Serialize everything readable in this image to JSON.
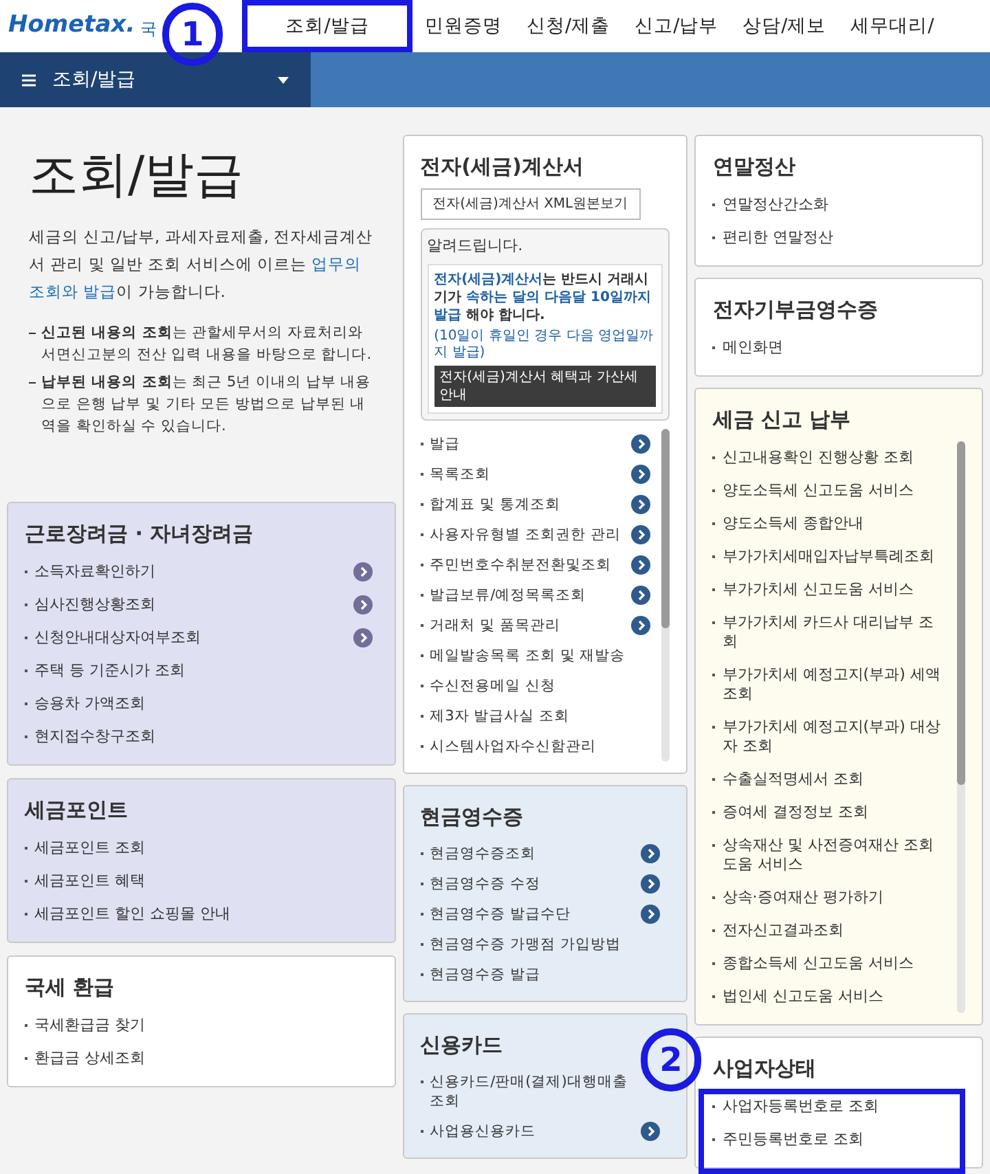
{
  "header": {
    "brand": "Hometax.",
    "subtitle": "국",
    "nav": [
      "조회/발급",
      "민원증명",
      "신청/제출",
      "신고/납부",
      "상담/제보",
      "세무대리/"
    ]
  },
  "menu_bar": {
    "title": "조회/발급"
  },
  "intro": {
    "title": "조회/발급",
    "paragraph": [
      {
        "text": "세금의 신고/납부, 과세자료제출, 전자세금계산서 관리 및 일반 조회 서비스에 이르는 ",
        "highlight": false
      },
      {
        "text": "업무의 조회와 발급",
        "highlight": true
      },
      {
        "text": "이 가능합니다.",
        "highlight": false
      }
    ],
    "notes": [
      "**신고된 내용의 조회**는 관할세무서의 자료처리와 서면신고분의 전산 입력 내용을 바탕으로 합니다.",
      "**납부된 내용의 조회**는 최근 5년 이내의 납부 내용으로 은행 납부 및 기타 모든 방법으로 납부된 내역을 확인하실 수 있습니다."
    ]
  },
  "columns": [
    [
      {
        "title": "근로장려금 · 자녀장려금",
        "color": "#dfe0f2",
        "kind": "plain",
        "items": [
          {
            "label": "소득자료확인하기",
            "arrow": true
          },
          {
            "label": "심사진행상황조회",
            "arrow": true
          },
          {
            "label": "신청안내대상자여부조회",
            "arrow": true
          },
          {
            "label": "주택 등 기준시가 조회",
            "arrow": false
          },
          {
            "label": "승용차 가액조회",
            "arrow": false
          },
          {
            "label": "현지접수창구조회",
            "arrow": false
          }
        ]
      },
      {
        "title": "세금포인트",
        "color": "#dfe0f2",
        "kind": "plain",
        "items": [
          {
            "label": "세금포인트 조회",
            "arrow": false
          },
          {
            "label": "세금포인트 혜택",
            "arrow": false
          },
          {
            "label": "세금포인트 할인 쇼핑몰 안내",
            "arrow": false
          }
        ]
      },
      {
        "title": "국세 환급",
        "color": "#ffffff",
        "kind": "plain",
        "items": [
          {
            "label": "국세환급금 찾기",
            "arrow": false
          },
          {
            "label": "환급금 상세조회",
            "arrow": false
          }
        ]
      }
    ],
    [
      {
        "title": "전자(세금)계산서",
        "color": "#ffffff",
        "kind": "scroll",
        "button": "전자(세금)계산서 XML원본보기",
        "notice": {
          "title": "알려드립니다.",
          "body": [
            {
              "text": "전자(세금)계산서",
              "highlight": true
            },
            {
              "text": "는 반드시 거래시기가 ",
              "highlight": false
            },
            {
              "text": "속하는 달의 다음달 10일까지 발급",
              "highlight": true
            },
            {
              "text": " 해야 합니다.",
              "highlight": false
            }
          ],
          "note": "(10일이 휴일인 경우 다음 영업일까지 발급)",
          "link": "전자(세금)계산서 혜택과 가산세 안내"
        },
        "items": [
          {
            "label": "발급",
            "arrow": true
          },
          {
            "label": "목록조회",
            "arrow": true
          },
          {
            "label": "합계표 및 통계조회",
            "arrow": true
          },
          {
            "label": "사용자유형별 조회권한 관리",
            "arrow": true
          },
          {
            "label": "주민번호수취분전환및조회",
            "arrow": true
          },
          {
            "label": "발급보류/예정목록조회",
            "arrow": true
          },
          {
            "label": "거래처 및 품목관리",
            "arrow": true
          },
          {
            "label": "메일발송목록 조회 및 재발송",
            "arrow": false
          },
          {
            "label": "수신전용메일 신청",
            "arrow": false
          },
          {
            "label": "제3자 발급사실 조회",
            "arrow": false
          },
          {
            "label": "시스템사업자수신함관리",
            "arrow": false
          }
        ]
      },
      {
        "title": "현금영수증",
        "color": "#e4ecf5",
        "kind": "plain",
        "items": [
          {
            "label": "현금영수증조회",
            "arrow": true
          },
          {
            "label": "현금영수증 수정",
            "arrow": true
          },
          {
            "label": "현금영수증 발급수단",
            "arrow": true
          },
          {
            "label": "현금영수증 가맹점 가입방법",
            "arrow": false
          },
          {
            "label": "현금영수증 발급",
            "arrow": false
          }
        ]
      },
      {
        "title": "신용카드",
        "color": "#e4ecf5",
        "kind": "plain",
        "items": [
          {
            "label": "신용카드/판매(결제)대행매출 조회",
            "arrow": false
          },
          {
            "label": "사업용신용카드",
            "arrow": true
          }
        ]
      }
    ],
    [
      {
        "title": "연말정산",
        "color": "#ffffff",
        "kind": "plain",
        "items": [
          {
            "label": "연말정산간소화",
            "arrow": false
          },
          {
            "label": "편리한 연말정산",
            "arrow": false
          }
        ]
      },
      {
        "title": "전자기부금영수증",
        "color": "#ffffff",
        "kind": "plain",
        "items": [
          {
            "label": "메인화면",
            "arrow": false
          }
        ]
      },
      {
        "title": "세금 신고 납부",
        "color": "#fdfcee",
        "kind": "scroll",
        "items": [
          {
            "label": "신고내용확인 진행상황 조회",
            "arrow": false
          },
          {
            "label": "양도소득세 신고도움 서비스",
            "arrow": false
          },
          {
            "label": "양도소득세 종합안내",
            "arrow": false
          },
          {
            "label": "부가가치세매입자납부특례조회",
            "arrow": false
          },
          {
            "label": "부가가치세 신고도움 서비스",
            "arrow": false
          },
          {
            "label": "부가가치세 카드사 대리납부 조회",
            "arrow": false
          },
          {
            "label": "부가가치세 예정고지(부과) 세액조회",
            "arrow": false
          },
          {
            "label": "부가가치세 예정고지(부과) 대상자 조회",
            "arrow": false
          },
          {
            "label": "수출실적명세서 조회",
            "arrow": false
          },
          {
            "label": "증여세 결정정보 조회",
            "arrow": false
          },
          {
            "label": "상속재산 및 사전증여재산 조회 도움 서비스",
            "arrow": false
          },
          {
            "label": "상속·증여재산 평가하기",
            "arrow": false
          },
          {
            "label": "전자신고결과조회",
            "arrow": false
          },
          {
            "label": "종합소득세 신고도움 서비스",
            "arrow": false
          },
          {
            "label": "법인세 신고도움 서비스",
            "arrow": false
          }
        ]
      },
      {
        "title": "사업자상태",
        "color": "#ffffff",
        "kind": "plain",
        "items": [
          {
            "label": "사업자등록번호로 조회",
            "arrow": false
          },
          {
            "label": "주민등록번호로 조회",
            "arrow": false
          }
        ]
      }
    ]
  ],
  "annotations": [
    {
      "number": "1"
    },
    {
      "number": "2"
    }
  ]
}
